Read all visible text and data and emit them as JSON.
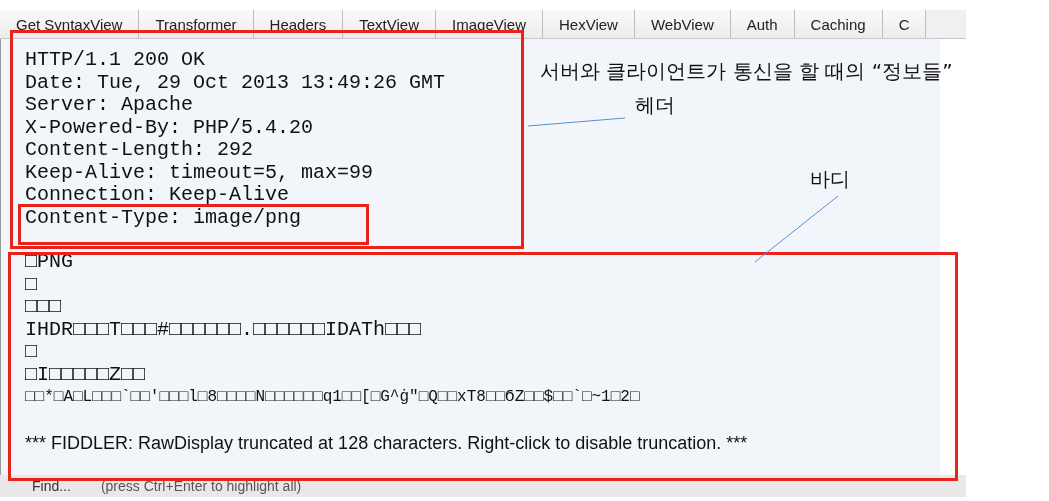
{
  "tabs": [
    {
      "label": "Get SyntaxView"
    },
    {
      "label": "Transformer"
    },
    {
      "label": "Headers"
    },
    {
      "label": "TextView"
    },
    {
      "label": "ImageView"
    },
    {
      "label": "HexView"
    },
    {
      "label": "WebView"
    },
    {
      "label": "Auth"
    },
    {
      "label": "Caching"
    },
    {
      "label": "C"
    }
  ],
  "header_lines": [
    "HTTP/1.1 200 OK",
    "Date: Tue, 29 Oct 2013 13:49:26 GMT",
    "Server: Apache",
    "X-Powered-By: PHP/5.4.20",
    "Content-Length: 292",
    "Keep-Alive: timeout=5, max=99",
    "Connection: Keep-Alive",
    "Content-Type: image/png"
  ],
  "body_lines": [
    "□PNG",
    "□",
    "□□□",
    "IHDR□□□T□□□#□□□□□□.□□□□□□IDATh□□□",
    "□",
    "□I□□□□□Z□□",
    "□□*□A□L□□□`□□'□□□l□8□□□□N□□□□□□q1□□[□G^ġ\"□Q□□xT8□□ϬZ□□$□□`□~1□2□"
  ],
  "truncation_notice": "*** FIDDLER: RawDisplay truncated at 128 characters. Right-click to disable truncation. ***",
  "annotations": [
    {
      "text": "서버와 클라이언트가 통신을 할 때의 “정보들”"
    },
    {
      "text": "헤더"
    },
    {
      "text": "바디"
    }
  ],
  "find_bar": {
    "label": "Find...",
    "placeholder": "(press Ctrl+Enter to highlight all)"
  }
}
